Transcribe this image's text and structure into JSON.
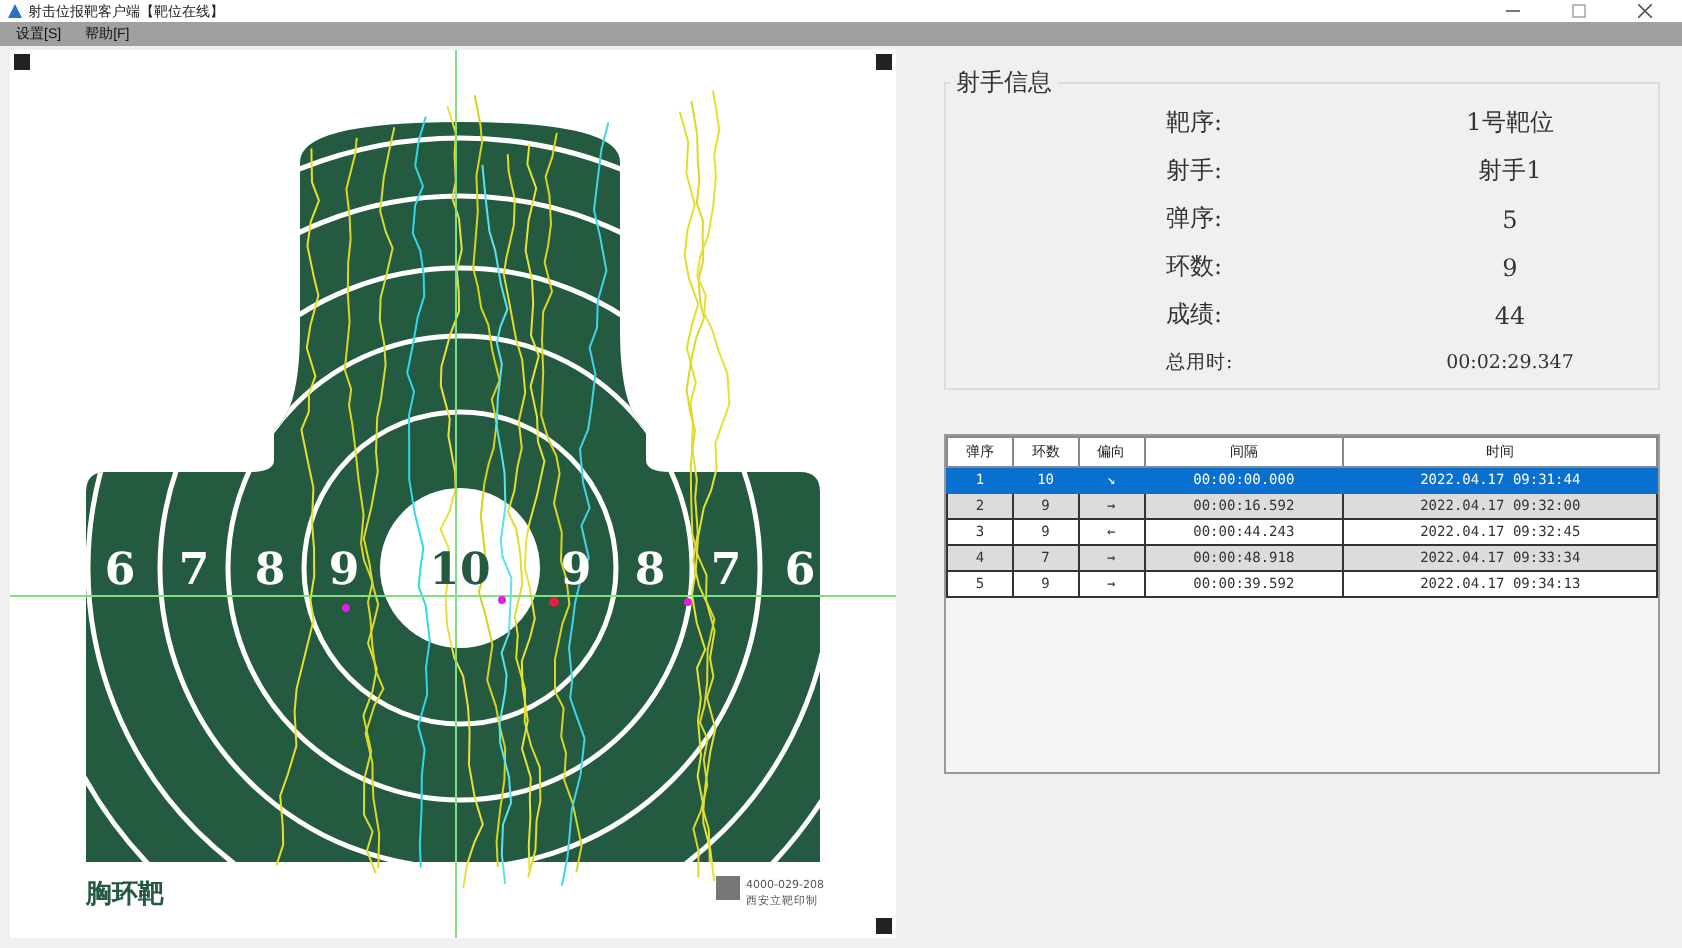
{
  "window": {
    "title": "射击位报靶客户端【靶位在线】"
  },
  "menu": [
    "设置[S]",
    "帮助[F]"
  ],
  "target": {
    "ring_labels": [
      "6",
      "7",
      "8",
      "9",
      "10",
      "9",
      "8",
      "7",
      "6"
    ],
    "name": "胸环靶",
    "phone": "4000-029-208",
    "maker": "西安立靶印制"
  },
  "shooter_info": {
    "title": "射手信息",
    "fields": [
      {
        "label": "靶序:",
        "value": "1号靶位"
      },
      {
        "label": "射手:",
        "value": "射手1"
      },
      {
        "label": "弹序:",
        "value": "5"
      },
      {
        "label": "环数:",
        "value": "9"
      },
      {
        "label": "成绩:",
        "value": "44"
      },
      {
        "label": "总用时:",
        "value": "00:02:29.347",
        "kind": "small"
      }
    ]
  },
  "table": {
    "columns": [
      "弹序",
      "环数",
      "偏向",
      "间隔",
      "时间"
    ],
    "rows": [
      {
        "cells": [
          "1",
          "10",
          "↘",
          "00:00:00.000",
          "2022.04.17 09:31:44"
        ],
        "selected": true
      },
      {
        "cells": [
          "2",
          "9",
          "→",
          "00:00:16.592",
          "2022.04.17 09:32:00"
        ],
        "selected": false
      },
      {
        "cells": [
          "3",
          "9",
          "←",
          "00:00:44.243",
          "2022.04.17 09:32:45"
        ],
        "selected": false
      },
      {
        "cells": [
          "4",
          "7",
          "→",
          "00:00:48.918",
          "2022.04.17 09:33:34"
        ],
        "selected": false
      },
      {
        "cells": [
          "5",
          "9",
          "→",
          "00:00:39.592",
          "2022.04.17 09:34:13"
        ],
        "selected": false
      }
    ]
  }
}
